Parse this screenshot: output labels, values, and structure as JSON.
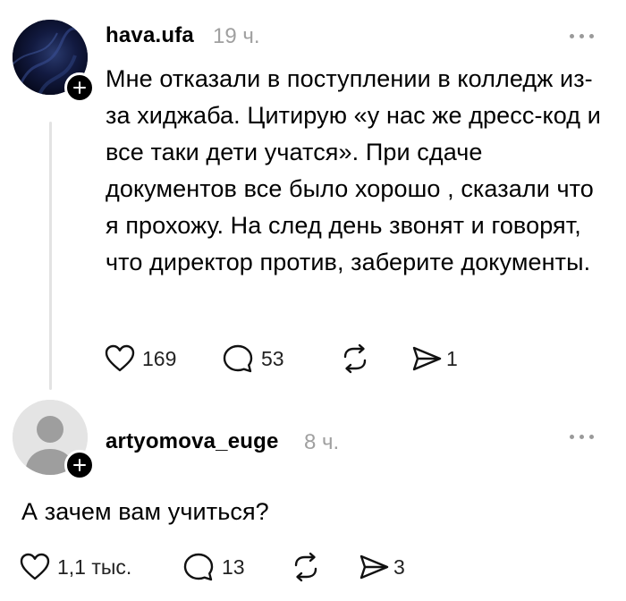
{
  "posts": [
    {
      "username": "hava.ufa",
      "time": "19 ч.",
      "text": "Мне отказали в поступлении в колледж из-за хиджаба. Цитирую «у нас же дресс-код и все таки дети учатся». При сдаче документов все было хорошо , сказали что я прохожу. На след день звонят и говорят, что директор против, заберите документы.",
      "likes": "169",
      "replies": "53",
      "reposts": "",
      "shares": "1",
      "avatar_icon": "dark-fabric-avatar",
      "avatar_color": "#0d1230"
    },
    {
      "username": "artyomova_euge",
      "time": "8 ч.",
      "text": "А зачем вам учиться?",
      "likes": "1,1 тыс.",
      "replies": "13",
      "reposts": "",
      "shares": "3",
      "avatar_icon": "default-person-avatar",
      "avatar_color": "#d0d0d0"
    }
  ],
  "icons": {
    "like": "heart-icon",
    "reply": "comment-bubble-icon",
    "repost": "repost-arrows-icon",
    "share": "send-paper-plane-icon",
    "follow": "plus-icon",
    "menu": "more-options-icon"
  }
}
